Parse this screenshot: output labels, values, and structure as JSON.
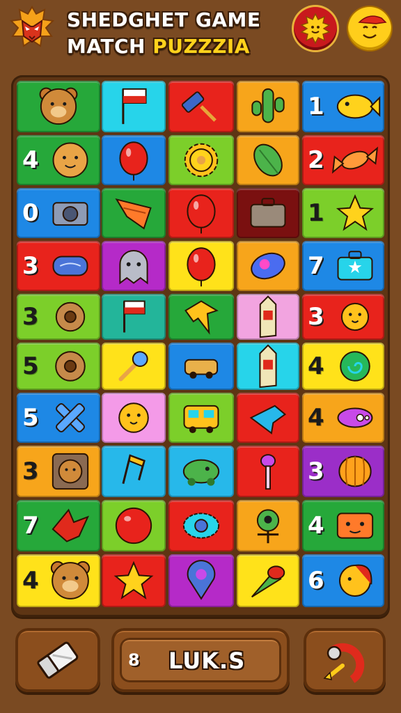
{
  "header": {
    "title_line1": "SHEDGHET GAME",
    "title_line2_prefix": "MATCH ",
    "title_line2_accent": "PUZZZIA",
    "logo_icon": "fox-mask-icon",
    "settings_icon": "sun-face-icon",
    "profile_icon": "smiley-cap-icon"
  },
  "colors": {
    "background": "#7a4a22",
    "board": "#5e3514",
    "accent_yellow": "#ffd21c"
  },
  "board": {
    "rows": [
      [
        {
          "bg": "#26a83a",
          "icon": "bear-icon",
          "number": ""
        },
        {
          "bg": "#27d4ea",
          "icon": "flag-icon",
          "number": ""
        },
        {
          "bg": "#e8231c",
          "icon": "hammer-icon",
          "number": ""
        },
        {
          "bg": "#f7a51b",
          "icon": "cactus-icon",
          "number": ""
        },
        {
          "bg": "#1e88e5",
          "icon": "fish-icon",
          "number": "1"
        }
      ],
      [
        {
          "bg": "#26a83a",
          "icon": "bear-face-icon",
          "number": "4"
        },
        {
          "bg": "#1e88e5",
          "icon": "balloon-icon",
          "number": ""
        },
        {
          "bg": "#7ccf2a",
          "icon": "gear-icon",
          "number": ""
        },
        {
          "bg": "#f7a51b",
          "icon": "leaf-icon",
          "number": ""
        },
        {
          "bg": "#e8231c",
          "icon": "candy-icon",
          "number": "2"
        }
      ],
      [
        {
          "bg": "#1e88e5",
          "icon": "camera-icon",
          "number": "0"
        },
        {
          "bg": "#26a83a",
          "icon": "bookmark-icon",
          "number": ""
        },
        {
          "bg": "#e8231c",
          "icon": "balloon-icon",
          "number": ""
        },
        {
          "bg": "#7a1010",
          "icon": "suitcase-icon",
          "number": ""
        },
        {
          "bg": "#7ccf2a",
          "icon": "star-icon",
          "number": "1"
        }
      ],
      [
        {
          "bg": "#e8231c",
          "icon": "toy-icon",
          "number": "3"
        },
        {
          "bg": "#b52ac8",
          "icon": "ghost-icon",
          "number": ""
        },
        {
          "bg": "#ffe21a",
          "icon": "balloon-icon",
          "number": ""
        },
        {
          "bg": "#f7a51b",
          "icon": "planet-icon",
          "number": ""
        },
        {
          "bg": "#1e88e5",
          "icon": "suitcase-star-icon",
          "number": "7"
        }
      ],
      [
        {
          "bg": "#7ccf2a",
          "icon": "donut-icon",
          "number": "3"
        },
        {
          "bg": "#23b59a",
          "icon": "flag-icon",
          "number": ""
        },
        {
          "bg": "#26a83a",
          "icon": "leaf-arrow-icon",
          "number": ""
        },
        {
          "bg": "#f2a4e0",
          "icon": "rocket-icon",
          "number": ""
        },
        {
          "bg": "#e8231c",
          "icon": "chick-icon",
          "number": "3"
        }
      ],
      [
        {
          "bg": "#7ccf2a",
          "icon": "donut-icon",
          "number": "5"
        },
        {
          "bg": "#ffe21a",
          "icon": "microphone-icon",
          "number": ""
        },
        {
          "bg": "#1e88e5",
          "icon": "toy-car-icon",
          "number": ""
        },
        {
          "bg": "#27d4ea",
          "icon": "rocket-icon",
          "number": ""
        },
        {
          "bg": "#ffe21a",
          "icon": "swirl-icon",
          "number": "4"
        }
      ],
      [
        {
          "bg": "#1e88e5",
          "icon": "cross-icon",
          "number": "5"
        },
        {
          "bg": "#f49ae8",
          "icon": "chick-icon",
          "number": ""
        },
        {
          "bg": "#7ccf2a",
          "icon": "bus-icon",
          "number": ""
        },
        {
          "bg": "#e8231c",
          "icon": "arrow-fish-icon",
          "number": ""
        },
        {
          "bg": "#f7a51b",
          "icon": "capsule-icon",
          "number": "4"
        }
      ],
      [
        {
          "bg": "#f7a51b",
          "icon": "bear-frame-icon",
          "number": "3"
        },
        {
          "bg": "#27b8ea",
          "icon": "music-note-icon",
          "number": ""
        },
        {
          "bg": "#27b8ea",
          "icon": "turtle-icon",
          "number": ""
        },
        {
          "bg": "#e8231c",
          "icon": "brush-icon",
          "number": ""
        },
        {
          "bg": "#9b2ec8",
          "icon": "pumpkin-icon",
          "number": "3"
        }
      ],
      [
        {
          "bg": "#26a83a",
          "icon": "bird-icon",
          "number": "7"
        },
        {
          "bg": "#7ccf2a",
          "icon": "ball-icon",
          "number": ""
        },
        {
          "bg": "#e8231c",
          "icon": "eye-icon",
          "number": ""
        },
        {
          "bg": "#f7a51b",
          "icon": "alien-icon",
          "number": ""
        },
        {
          "bg": "#26a83a",
          "icon": "box-face-icon",
          "number": "4"
        }
      ],
      [
        {
          "bg": "#ffe21a",
          "icon": "bear-icon",
          "number": "4"
        },
        {
          "bg": "#e8231c",
          "icon": "star-icon",
          "number": ""
        },
        {
          "bg": "#b52ac8",
          "icon": "pin-icon",
          "number": ""
        },
        {
          "bg": "#ffe21a",
          "icon": "carrot-icon",
          "number": ""
        },
        {
          "bg": "#1e88e5",
          "icon": "bird-face-icon",
          "number": "6"
        }
      ]
    ]
  },
  "footer": {
    "left_icon": "eraser-icon",
    "count": "8",
    "label": "LUK.S",
    "right_icon": "magnet-icon"
  }
}
